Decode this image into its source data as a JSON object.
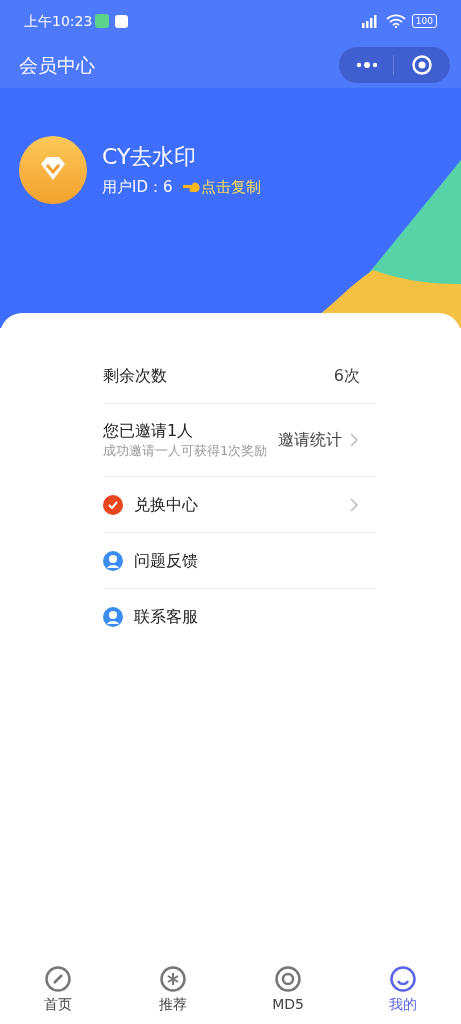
{
  "status_bar": {
    "time": "上午10:23",
    "battery": "100"
  },
  "nav_bar": {
    "title": "会员中心"
  },
  "profile": {
    "name": "CY去水印",
    "user_id_label": "用户ID：",
    "user_id": "6",
    "copy_link": "点击复制"
  },
  "menu": [
    {
      "kind": "value",
      "label": "剩余次数",
      "value": "6次"
    },
    {
      "kind": "invite",
      "label": "您已邀请1人",
      "subtitle": "成功邀请一人可获得1次奖励",
      "action": "邀请统计",
      "has_arrow": true
    },
    {
      "kind": "redeem",
      "label": "兑换中心",
      "has_arrow": true
    },
    {
      "kind": "support",
      "label": "问题反馈",
      "has_arrow": false
    },
    {
      "kind": "support",
      "label": "联系客服",
      "has_arrow": false
    }
  ],
  "tab_bar": [
    {
      "label": "首页",
      "selected": false
    },
    {
      "label": "推荐",
      "selected": false
    },
    {
      "label": "MD5",
      "selected": false
    },
    {
      "label": "我的",
      "selected": true
    }
  ]
}
